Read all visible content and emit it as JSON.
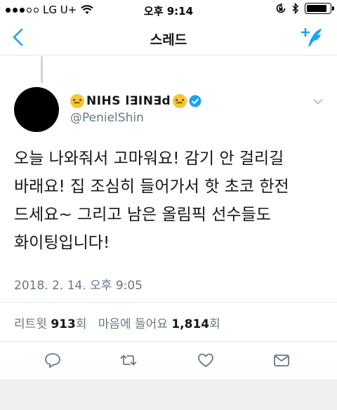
{
  "status_bar": {
    "carrier": "LG U+",
    "time": "오후 9:14",
    "battery_level": 0.9
  },
  "nav": {
    "title": "스레드"
  },
  "tweet": {
    "display_name": "NIHS l∃IN∃d",
    "handle": "@PenielShin",
    "text_lines": [
      "오늘 나와줘서 고마워요! 감기 안 걸리길",
      "바래요! 집 조심히 들어가서 핫 초코 한전",
      "드세요~ 그리고 남은 올림픽 선수들도",
      "화이팅입니다!"
    ],
    "timestamp": "2018. 2. 14. 오후 9:05"
  },
  "stats": {
    "retweets_label": "리트윗",
    "retweets_count": "913",
    "retweets_suffix": "회",
    "likes_label": "마음에 들어요",
    "likes_count": "1,814",
    "likes_suffix": "회"
  },
  "colors": {
    "accent": "#1da1f2",
    "text": "#14171a",
    "secondary": "#657786",
    "divider": "#e1e8ed"
  },
  "icons": {
    "back": "chevron-left-icon",
    "compose": "compose-tweet-icon",
    "verified": "verified-badge-icon",
    "reply": "reply-icon",
    "retweet": "retweet-icon",
    "like": "heart-icon",
    "dm": "envelope-icon"
  }
}
